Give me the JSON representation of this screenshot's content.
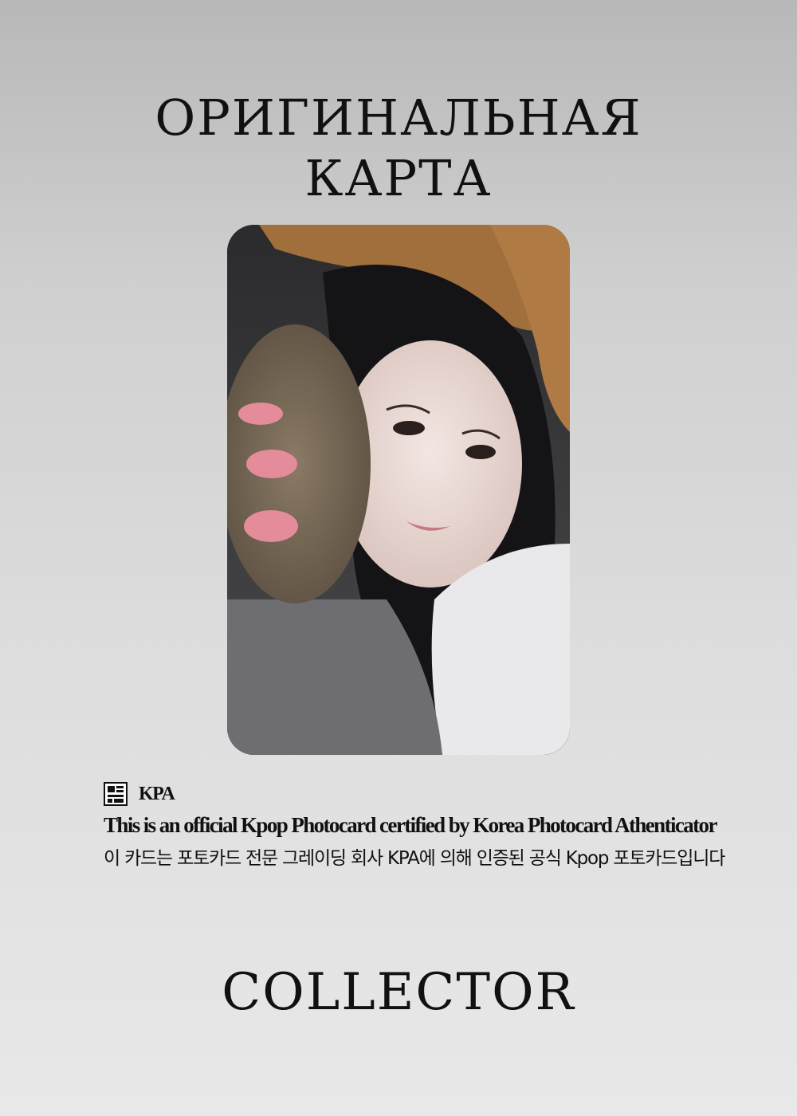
{
  "title": {
    "line1": "ОРИГИНАЛЬНАЯ",
    "line2": "КАРТА"
  },
  "certificate": {
    "brand": "KPA",
    "english": "This is an official Kpop Photocard certified by Korea Photocard Athenticator",
    "korean": "이 카드는 포토카드 전문 그레이딩 회사 KPA에 의해 인증된 공식 Kpop 포토카드입니다"
  },
  "footer": {
    "label": "COLLECTOR"
  },
  "photo": {
    "icon": "photo-of-person-with-plush-paw"
  }
}
